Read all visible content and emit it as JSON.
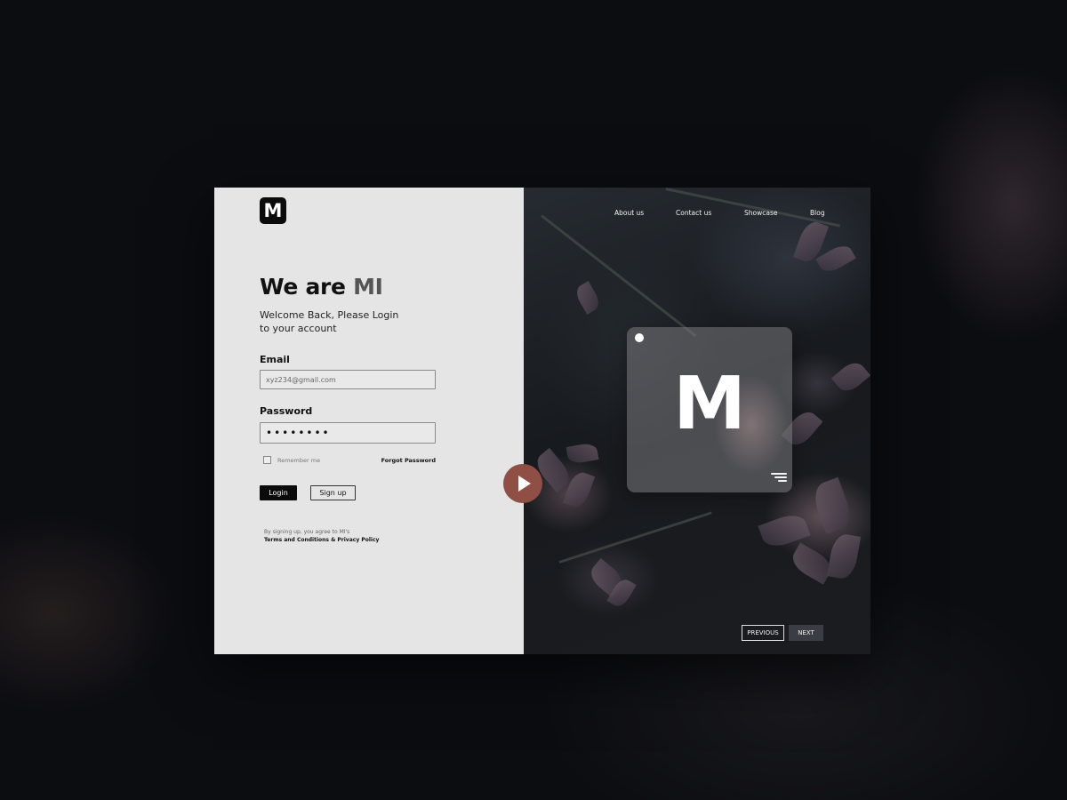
{
  "brand": {
    "logo_letter": "M"
  },
  "login": {
    "heading_prefix": "We are ",
    "heading_accent": "MI",
    "subtitle": "Welcome Back, Please Login to your account",
    "email_label": "Email",
    "email_value": "xyz234@gmail.com",
    "password_label": "Password",
    "password_value": "••••••••",
    "remember_label": "Remember me",
    "forgot_label": "Forgot Password",
    "login_button": "Login",
    "signup_button": "Sign up",
    "terms_text": "By signing up, you agree to MI's",
    "terms_link": "Terms and Conditions & Privacy Policy"
  },
  "nav": {
    "items": [
      "About us",
      "Contact us",
      "Showcase",
      "Blog"
    ]
  },
  "showcase": {
    "card_letter": "M",
    "previous_button": "PREVIOUS",
    "next_button": "NEXT"
  },
  "icons": {
    "play": "play-icon",
    "menu": "menu-icon",
    "dot": "dot-indicator"
  },
  "colors": {
    "play_button": "#8f4f44",
    "left_panel": "#e5e5e5",
    "primary_button": "#0b0b0b"
  }
}
